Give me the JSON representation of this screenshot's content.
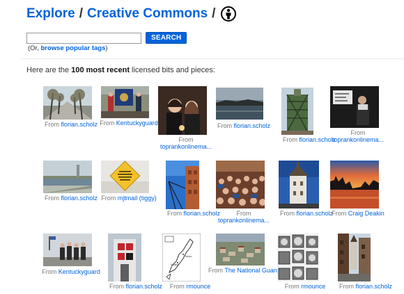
{
  "header": {
    "explore_link": "Explore",
    "separator1": "/",
    "cc_link": "Creative Commons",
    "separator2": "/",
    "license_icon": "attribution-icon"
  },
  "search": {
    "input_value": "",
    "button_label": "SEARCH",
    "sub_prefix": "(Or,",
    "sub_link": "browse popular tags",
    "sub_suffix": ")"
  },
  "intro": {
    "prefix": "Here are the",
    "bold": "100 most recent",
    "suffix": "licensed bits and pieces:"
  },
  "photos": [
    {
      "from": "From",
      "user": "florian.scholz",
      "inline": true
    },
    {
      "from": "From",
      "user": "Kentuckyguard",
      "inline": true
    },
    {
      "from": "From",
      "user": "toprankonlinema...",
      "inline": false
    },
    {
      "from": "From",
      "user": "florian.scholz",
      "inline": true
    },
    {
      "from": "From",
      "user": "florian.scholz",
      "inline": true
    },
    {
      "from": "From",
      "user": "toprankonlinema...",
      "inline": false
    },
    {
      "from": "From",
      "user": "florian.scholz",
      "inline": true
    },
    {
      "from": "From",
      "user": "mjtmail (tiggy)",
      "inline": true
    },
    {
      "from": "From",
      "user": "florian.scholz",
      "inline": true
    },
    {
      "from": "From",
      "user": "toprankonlinema...",
      "inline": false
    },
    {
      "from": "From",
      "user": "florian.scholz",
      "inline": true
    },
    {
      "from": "From",
      "user": "Craig Deakin",
      "inline": true
    },
    {
      "from": "From",
      "user": "Kentuckyguard",
      "inline": true
    },
    {
      "from": "From",
      "user": "florian.scholz",
      "inline": true
    },
    {
      "from": "From",
      "user": "rmounce",
      "inline": true
    },
    {
      "from": "From",
      "user": "The National Guard",
      "inline": false
    },
    {
      "from": "From",
      "user": "rmounce",
      "inline": true
    },
    {
      "from": "From",
      "user": "florian.scholz",
      "inline": true
    }
  ],
  "poster_text": "Sorry to be dear but I do not want the moving in so I found a sign.",
  "map_labels": {
    "a": "Tokyo",
    "b": "Osaka"
  }
}
